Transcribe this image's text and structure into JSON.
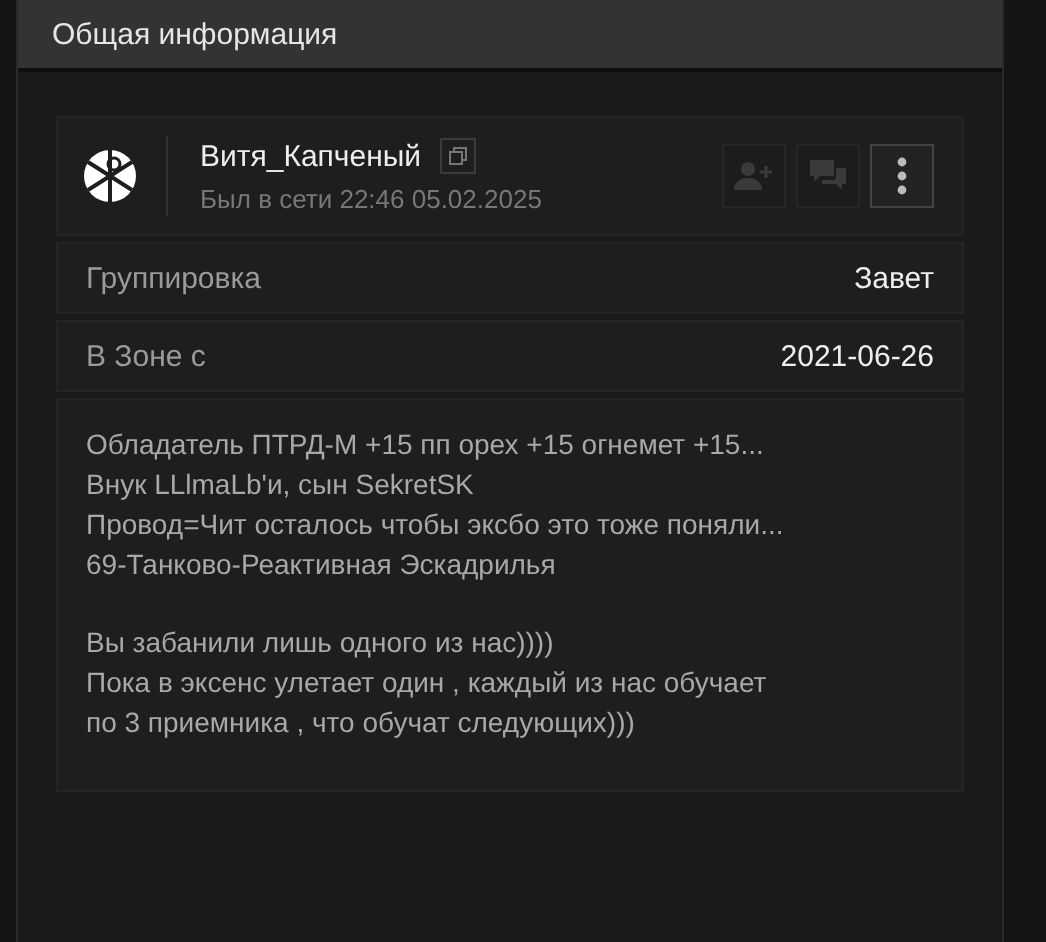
{
  "panel": {
    "title": "Общая информация"
  },
  "profile": {
    "name": "Витя_Капченый",
    "last_seen": "Был в сети 22:46 05.02.2025",
    "buttons": [
      {
        "kind": "add-friend",
        "disabled": true
      },
      {
        "kind": "message",
        "disabled": true
      },
      {
        "kind": "menu",
        "disabled": false
      }
    ]
  },
  "fields": [
    {
      "label": "Группировка",
      "value": "Завет"
    },
    {
      "label": "В Зоне с",
      "value": "2021-06-26"
    }
  ],
  "bio": [
    "Обладатель ПТРД-М +15 пп орех +15 огнемет +15...\nВнук LLlmaLb'и, сын SekretSK\nПровод=Чит осталось чтобы эксбо это тоже поняли...\n69-Танково-Реактивная Эскадрилья",
    "Вы забанили лишь одного из нас))))\nПока в эксенс улетает один , каждый из нас обучает\nпо 3 приемника , что обучат следующих)))"
  ]
}
